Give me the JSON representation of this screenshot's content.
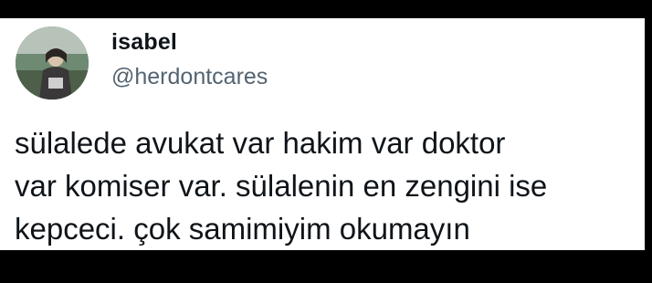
{
  "author": {
    "display_name": "isabel",
    "handle": "@herdontcares",
    "avatar_icon": "profile-photo"
  },
  "tweet": {
    "lines": [
      "sülalede avukat var hakim var doktor",
      "var komiser var. sülalenin en zengini ise",
      "kepceci. çok samimiyim okumayın"
    ]
  },
  "colors": {
    "background": "#000000",
    "card": "#ffffff",
    "text_primary": "#0f1419",
    "text_secondary": "#536471"
  }
}
